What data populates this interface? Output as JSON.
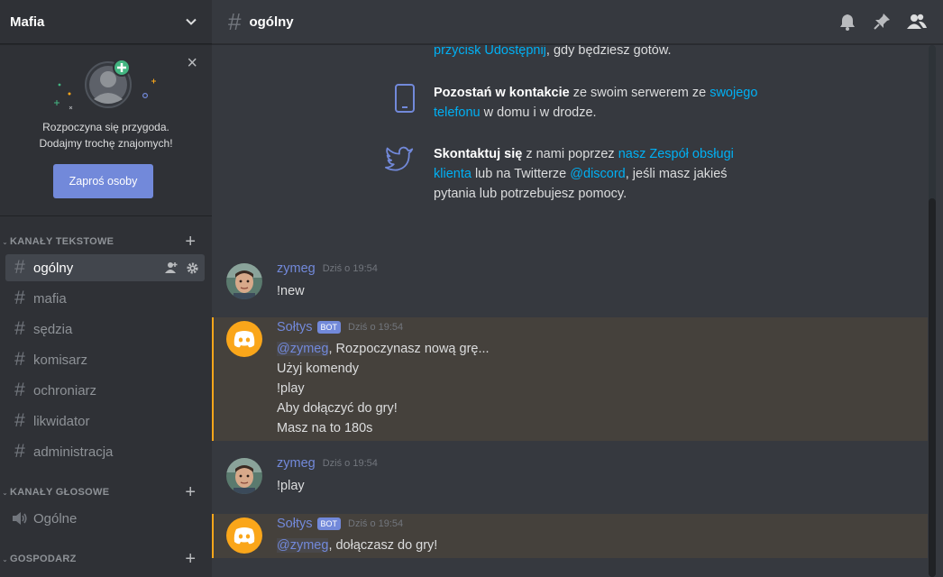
{
  "server": {
    "name": "Mafia"
  },
  "invite": {
    "line1": "Rozpoczyna się przygoda.",
    "line2": "Dodajmy trochę znajomych!",
    "button": "Zaproś osoby",
    "close": "×"
  },
  "categories": {
    "text": "KANAŁY TEKSTOWE",
    "voice": "KANAŁY GŁOSOWE",
    "host": "GOSPODARZ"
  },
  "text_channels": [
    {
      "name": "ogólny",
      "active": true
    },
    {
      "name": "mafia"
    },
    {
      "name": "sędzia"
    },
    {
      "name": "komisarz"
    },
    {
      "name": "ochroniarz"
    },
    {
      "name": "likwidator"
    },
    {
      "name": "administracja"
    }
  ],
  "voice_channels": [
    {
      "name": "Ogólne"
    }
  ],
  "header": {
    "channel": "ogólny"
  },
  "welcome": {
    "share": {
      "link": "przycisk Udostępnij",
      "rest": ", gdy będziesz gotów."
    },
    "mobile": {
      "bold": "Pozostań w kontakcie",
      "mid": " ze swoim serwerem ze ",
      "link": "swojego telefonu",
      "rest": " w domu i w drodze."
    },
    "twitter": {
      "bold": "Skontaktuj się",
      "mid": " z nami poprzez ",
      "link": "nasz Zespół obsługi klienta",
      "mid2": " lub na Twitterze ",
      "link2": "@discord",
      "rest": ", jeśli masz jakieś pytania lub potrzebujesz pomocy."
    }
  },
  "messages": [
    {
      "author": "zymeg",
      "time": "Dziś o 19:54",
      "lines": [
        "!new"
      ]
    },
    {
      "author": "Sołtys",
      "bot": "BOT",
      "time": "Dziś o 19:54",
      "mention": "@zymeg",
      "first_rest": ", Rozpoczynasz nową grę...",
      "lines": [
        "Użyj komendy",
        "!play",
        "Aby dołączyć do gry!",
        "Masz na to 180s"
      ]
    },
    {
      "author": "zymeg",
      "time": "Dziś o 19:54",
      "lines": [
        "!play"
      ]
    },
    {
      "author": "Sołtys",
      "bot": "BOT",
      "time": "Dziś o 19:54",
      "mention": "@zymeg",
      "first_rest": ", dołączasz do gry!",
      "lines": []
    }
  ],
  "colors": {
    "accent": "#7289da",
    "link": "#00b0f4",
    "highlight": "#faa61a",
    "bot_avatar": "#faa61a"
  }
}
